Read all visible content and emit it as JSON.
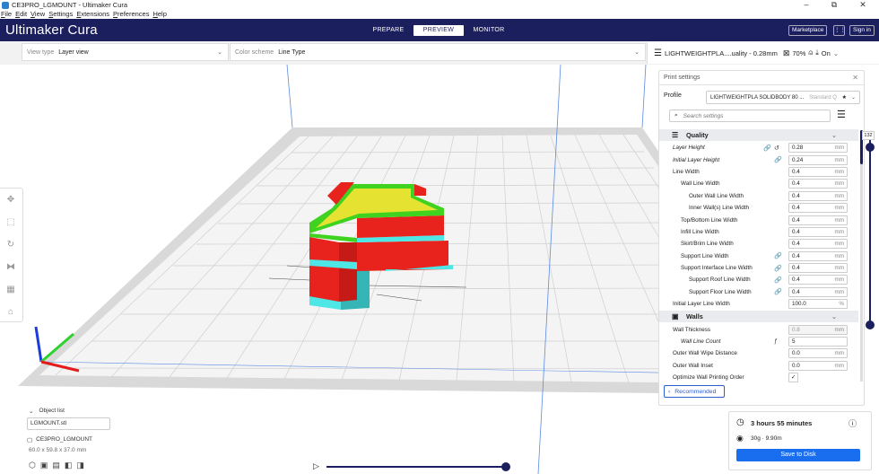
{
  "window": {
    "title": "CE3PRO_LGMOUNT - Ultimaker Cura",
    "minimize": "–",
    "maximize": "⧉",
    "close": "✕"
  },
  "menu": [
    {
      "key": "F",
      "rest": "ile"
    },
    {
      "key": "E",
      "rest": "dit"
    },
    {
      "key": "V",
      "rest": "iew"
    },
    {
      "key": "S",
      "rest": "ettings"
    },
    {
      "key": "E",
      "rest": "xtensions"
    },
    {
      "key": "P",
      "rest": "references"
    },
    {
      "key": "H",
      "rest": "elp"
    }
  ],
  "header": {
    "brand": "Ultimaker Cura",
    "stages": [
      "PREPARE",
      "PREVIEW",
      "MONITOR"
    ],
    "active_stage": "PREVIEW",
    "marketplace": "Marketplace",
    "signin": "Sign in"
  },
  "view_type": {
    "label": "View type",
    "value": "Layer view"
  },
  "color_scheme": {
    "label": "Color scheme",
    "value": "Line Type"
  },
  "print_selector": {
    "profile": "LIGHTWEIGHTPLA....uality - 0.28mm",
    "infill": "70%",
    "support": "On"
  },
  "panel": {
    "title": "Print settings",
    "profile_label": "Profile",
    "profile_value": "LIGHTWEIGHTPLA SOLIDBODY 80 ...",
    "profile_hint": "Standard Q",
    "search_placeholder": "Search settings",
    "categories": [
      {
        "name": "Quality",
        "icon": "layers-icon",
        "settings": [
          {
            "name": "Layer Height",
            "indent": 0,
            "italic": true,
            "icons": [
              "link-icon",
              "reset-icon"
            ],
            "value": "0.28",
            "unit": "mm"
          },
          {
            "name": "Initial Layer Height",
            "indent": 0,
            "italic": true,
            "icons": [
              "link-icon"
            ],
            "value": "0.24",
            "unit": "mm"
          },
          {
            "name": "Line Width",
            "indent": 0,
            "icons": [],
            "value": "0.4",
            "unit": "mm"
          },
          {
            "name": "Wall Line Width",
            "indent": 1,
            "icons": [],
            "value": "0.4",
            "unit": "mm"
          },
          {
            "name": "Outer Wall Line Width",
            "indent": 2,
            "icons": [],
            "value": "0.4",
            "unit": "mm"
          },
          {
            "name": "Inner Wall(s) Line Width",
            "indent": 2,
            "icons": [],
            "value": "0.4",
            "unit": "mm"
          },
          {
            "name": "Top/Bottom Line Width",
            "indent": 1,
            "icons": [],
            "value": "0.4",
            "unit": "mm"
          },
          {
            "name": "Infill Line Width",
            "indent": 1,
            "icons": [],
            "value": "0.4",
            "unit": "mm"
          },
          {
            "name": "Skirt/Brim Line Width",
            "indent": 1,
            "icons": [],
            "value": "0.4",
            "unit": "mm"
          },
          {
            "name": "Support Line Width",
            "indent": 1,
            "icons": [
              "link-icon"
            ],
            "value": "0.4",
            "unit": "mm"
          },
          {
            "name": "Support Interface Line Width",
            "indent": 1,
            "icons": [
              "link-icon"
            ],
            "value": "0.4",
            "unit": "mm"
          },
          {
            "name": "Support Roof Line Width",
            "indent": 2,
            "icons": [
              "link-icon"
            ],
            "value": "0.4",
            "unit": "mm"
          },
          {
            "name": "Support Floor Line Width",
            "indent": 2,
            "icons": [
              "link-icon"
            ],
            "value": "0.4",
            "unit": "mm"
          },
          {
            "name": "Initial Layer Line Width",
            "indent": 0,
            "icons": [],
            "value": "100.0",
            "unit": "%"
          }
        ]
      },
      {
        "name": "Walls",
        "icon": "walls-icon",
        "settings": [
          {
            "name": "Wall Thickness",
            "indent": 0,
            "icons": [],
            "value": "0.8",
            "unit": "mm",
            "disabled": true
          },
          {
            "name": "Wall Line Count",
            "indent": 1,
            "italic": true,
            "icons": [
              "function-icon"
            ],
            "value": "5",
            "unit": ""
          },
          {
            "name": "Outer Wall Wipe Distance",
            "indent": 0,
            "icons": [],
            "value": "0.0",
            "unit": "mm"
          },
          {
            "name": "Outer Wall Inset",
            "indent": 0,
            "icons": [],
            "value": "0.0",
            "unit": "mm"
          },
          {
            "name": "Optimize Wall Printing Order",
            "indent": 0,
            "icons": [],
            "checkbox": true
          }
        ]
      }
    ],
    "recommended_label": "Recommended"
  },
  "layer_slider": {
    "top_value": "132"
  },
  "object_list": {
    "label": "Object list",
    "file": "LGMOUNT.stl",
    "object_name": "CE3PRO_LGMOUNT",
    "dimensions": "60.0 x 59.8 x 37.0 mm"
  },
  "estimate": {
    "time": "3 hours 55 minutes",
    "material": "30g · 9.90m",
    "save_button": "Save to Disk"
  },
  "colors": {
    "header": "#1c1f5e",
    "accent": "#196ef0",
    "model_red": "#e8231d",
    "model_yellow": "#e6e232",
    "model_green": "#3fd21f",
    "support_cyan": "#4fe6e6"
  }
}
